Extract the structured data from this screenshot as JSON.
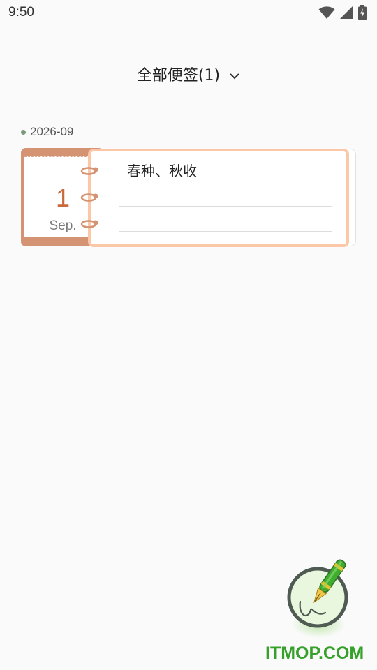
{
  "status_bar": {
    "time": "9:50",
    "icons": [
      "wifi-icon",
      "cellular-signal-icon",
      "battery-charging-icon"
    ]
  },
  "header": {
    "title": "全部便签(1)",
    "dropdown_icon": "chevron-down-icon"
  },
  "notes": {
    "group_label": "2026-09",
    "items": [
      {
        "day": "1",
        "month": "Sep.",
        "text": "春种、秋收"
      }
    ]
  },
  "fab": {
    "icon": "pen-write-icon"
  },
  "watermark": {
    "text": "ITMOP.COM"
  },
  "colors": {
    "background": "#fafafa",
    "date_panel": "#d49372",
    "day_number": "#c9693c",
    "paper_border": "#fcc7a6",
    "group_dot": "#7a9a7a",
    "fab_border": "#4f5a52",
    "fab_fill": "#e9f7df",
    "watermark": "#36a12a"
  }
}
